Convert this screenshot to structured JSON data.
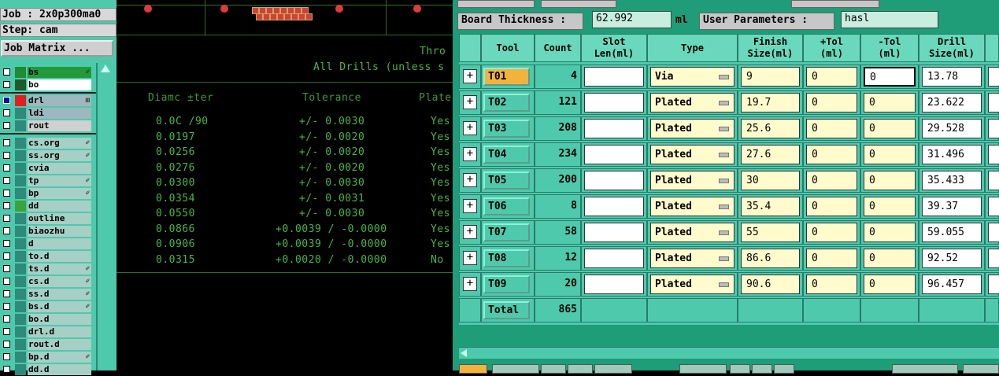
{
  "left": {
    "job": "Job : 2x0p300ma0",
    "step": "Step: cam",
    "job_matrix": "Job Matrix ...",
    "layers": [
      {
        "name": "bs",
        "style": "green",
        "color": "#1e8a32",
        "check": "normal",
        "mark": "✐"
      },
      {
        "name": "bo",
        "style": "white",
        "color": "#1e5a2a",
        "check": "normal",
        "mark": ""
      },
      {
        "name": "drl",
        "style": "slate",
        "color": "#e02020",
        "check": "selected",
        "mark": "⊞"
      },
      {
        "name": "ldi",
        "style": "slate",
        "color": "#2e8a7a",
        "check": "normal",
        "mark": ""
      },
      {
        "name": "rout",
        "style": "gray",
        "color": "#2e8a7a",
        "check": "normal",
        "mark": ""
      },
      {
        "name": "cs.org",
        "style": "normal",
        "color": "#2e8a7a",
        "check": "normal",
        "mark": "✐"
      },
      {
        "name": "ss.org",
        "style": "normal",
        "color": "#2e8a7a",
        "check": "normal",
        "mark": "✐"
      },
      {
        "name": "cvia",
        "style": "normal",
        "color": "#2e8a7a",
        "check": "normal",
        "mark": ""
      },
      {
        "name": "tp",
        "style": "normal",
        "color": "#2e8a7a",
        "check": "normal",
        "mark": "✐"
      },
      {
        "name": "bp",
        "style": "normal",
        "color": "#2e8a7a",
        "check": "normal",
        "mark": "✐"
      },
      {
        "name": "dd",
        "style": "normal",
        "color": "#3aa33a",
        "check": "normal",
        "mark": ""
      },
      {
        "name": "outline",
        "style": "normal",
        "color": "#2e8a7a",
        "check": "normal",
        "mark": ""
      },
      {
        "name": "biaozhu",
        "style": "normal",
        "color": "#2e8a7a",
        "check": "normal",
        "mark": ""
      },
      {
        "name": "d",
        "style": "normal",
        "color": "#2e8a7a",
        "check": "normal",
        "mark": ""
      },
      {
        "name": "to.d",
        "style": "normal",
        "color": "#2e8a7a",
        "check": "normal",
        "mark": ""
      },
      {
        "name": "ts.d",
        "style": "normal",
        "color": "#2e8a7a",
        "check": "normal",
        "mark": "✐"
      },
      {
        "name": "cs.d",
        "style": "normal",
        "color": "#2e8a7a",
        "check": "normal",
        "mark": "✐"
      },
      {
        "name": "ss.d",
        "style": "normal",
        "color": "#2e8a7a",
        "check": "normal",
        "mark": "✐"
      },
      {
        "name": "bs.d",
        "style": "normal",
        "color": "#2e8a7a",
        "check": "normal",
        "mark": "✐"
      },
      {
        "name": "bo.d",
        "style": "normal",
        "color": "#2e8a7a",
        "check": "normal",
        "mark": ""
      },
      {
        "name": "drl.d",
        "style": "normal",
        "color": "#2e8a7a",
        "check": "normal",
        "mark": ""
      },
      {
        "name": "rout.d",
        "style": "normal",
        "color": "#2e8a7a",
        "check": "normal",
        "mark": ""
      },
      {
        "name": "bp.d",
        "style": "normal",
        "color": "#2e8a7a",
        "check": "normal",
        "mark": "✐"
      },
      {
        "name": "dd.d",
        "style": "normal",
        "color": "#2e8a7a",
        "check": "normal",
        "mark": ""
      }
    ]
  },
  "canvas": {
    "text_thro": "Thro",
    "text_all": "All Drills (unless s",
    "headers": [
      "Diamc ±ter",
      "Tolerance",
      "Plate"
    ],
    "rows": [
      {
        "d": "0.0C /90",
        "t": "+/- 0.0030",
        "p": "Yes"
      },
      {
        "d": "0.0197",
        "t": "+/- 0.0020",
        "p": "Yes"
      },
      {
        "d": "0.0256",
        "t": "+/- 0.0020",
        "p": "Yes"
      },
      {
        "d": "0.0276",
        "t": "+/- 0.0020",
        "p": "Yes"
      },
      {
        "d": "0.0300",
        "t": "+/- 0.0030",
        "p": "Yes"
      },
      {
        "d": "0.0354",
        "t": "+/- 0.0031",
        "p": "Yes"
      },
      {
        "d": "0.0550",
        "t": "+/- 0.0030",
        "p": "Yes"
      },
      {
        "d": "0.0866",
        "t": "+0.0039 / -0.0000",
        "p": "Yes"
      },
      {
        "d": "0.0906",
        "t": "+0.0039 / -0.0000",
        "p": "Yes"
      },
      {
        "d": "0.0315",
        "t": "+0.0020 / -0.0000",
        "p": "No"
      }
    ]
  },
  "right": {
    "board_thickness_label": "Board Thickness :",
    "board_thickness_value": "62.992",
    "board_thickness_unit": "ml",
    "user_params_label": "User Parameters :",
    "user_params_value": "hasl",
    "columns": [
      "Tool",
      "Count",
      "Slot\nLen(ml)",
      "Type",
      "Finish\nSize(ml)",
      "+Tol\n(ml)",
      "-Tol\n(ml)",
      "Drill\nSize(ml)"
    ],
    "rows": [
      {
        "tool": "T01",
        "count": "4",
        "slot": "",
        "type": "Via",
        "finish": "9",
        "ptol": "0",
        "mtol": "0",
        "drill": "13.78",
        "active": true
      },
      {
        "tool": "T02",
        "count": "121",
        "slot": "",
        "type": "Plated",
        "finish": "19.7",
        "ptol": "0",
        "mtol": "0",
        "drill": "23.622",
        "active": false
      },
      {
        "tool": "T03",
        "count": "208",
        "slot": "",
        "type": "Plated",
        "finish": "25.6",
        "ptol": "0",
        "mtol": "0",
        "drill": "29.528",
        "active": false
      },
      {
        "tool": "T04",
        "count": "234",
        "slot": "",
        "type": "Plated",
        "finish": "27.6",
        "ptol": "0",
        "mtol": "0",
        "drill": "31.496",
        "active": false
      },
      {
        "tool": "T05",
        "count": "200",
        "slot": "",
        "type": "Plated",
        "finish": "30",
        "ptol": "0",
        "mtol": "0",
        "drill": "35.433",
        "active": false
      },
      {
        "tool": "T06",
        "count": "8",
        "slot": "",
        "type": "Plated",
        "finish": "35.4",
        "ptol": "0",
        "mtol": "0",
        "drill": "39.37",
        "active": false
      },
      {
        "tool": "T07",
        "count": "58",
        "slot": "",
        "type": "Plated",
        "finish": "55",
        "ptol": "0",
        "mtol": "0",
        "drill": "59.055",
        "active": false
      },
      {
        "tool": "T08",
        "count": "12",
        "slot": "",
        "type": "Plated",
        "finish": "86.6",
        "ptol": "0",
        "mtol": "0",
        "drill": "92.52",
        "active": false
      },
      {
        "tool": "T09",
        "count": "20",
        "slot": "",
        "type": "Plated",
        "finish": "90.6",
        "ptol": "0",
        "mtol": "0",
        "drill": "96.457",
        "active": false
      }
    ],
    "total_label": "Total",
    "total_count": "865"
  }
}
